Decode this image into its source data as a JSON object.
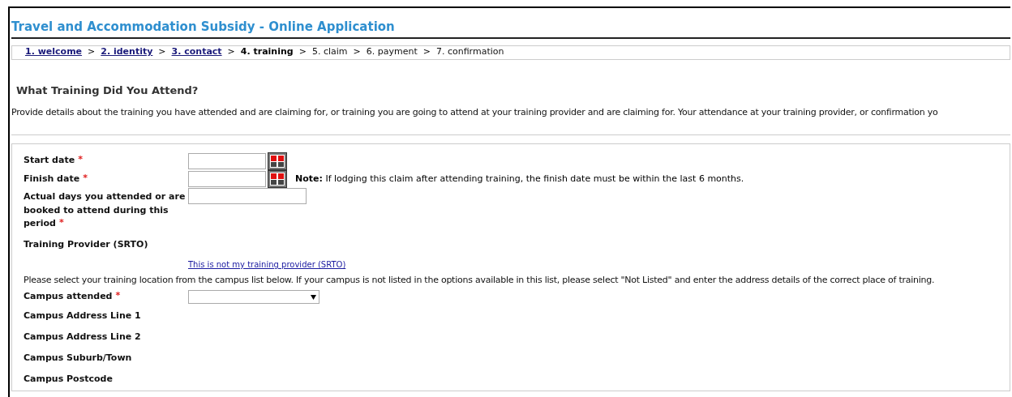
{
  "title": "Travel and Accommodation Subsidy - Online Application",
  "breadcrumb": {
    "separator": ">",
    "steps": [
      {
        "label": "1. welcome",
        "kind": "link"
      },
      {
        "label": "2. identity",
        "kind": "link"
      },
      {
        "label": "3. contact",
        "kind": "link"
      },
      {
        "label": "4. training",
        "kind": "current"
      },
      {
        "label": "5. claim",
        "kind": "plain"
      },
      {
        "label": "6. payment",
        "kind": "plain"
      },
      {
        "label": "7. confirmation",
        "kind": "plain"
      }
    ]
  },
  "heading": "What Training Did You Attend?",
  "intro": "Provide details about the training you have attended and are claiming for, or training you are going to attend at your training provider and are claiming for. Your attendance at your training provider, or confirmation yo",
  "rows": [
    {
      "kind": "date",
      "label": "Start date",
      "required_mark": "*"
    },
    {
      "kind": "date",
      "label": "Finish date",
      "required_mark": "*",
      "note_label": "Note:",
      "note": "If lodging this claim after attending training, the finish date must be within the last 6 months."
    },
    {
      "kind": "text",
      "label": "Actual days you attended or are booked to attend during this period",
      "required_mark": "*"
    },
    {
      "kind": "info",
      "label": "Training Provider (SRTO)"
    },
    {
      "kind": "link",
      "link": "This is not my training provider (SRTO)"
    },
    {
      "kind": "sentence",
      "text": "Please select your training location from the campus list below. If your campus is not listed in the options available in this list, please select \"Not Listed\" and enter the address details of the correct place of training."
    },
    {
      "kind": "select",
      "label": "Campus attended",
      "required_mark": "*"
    },
    {
      "kind": "info",
      "label": "Campus Address Line 1"
    },
    {
      "kind": "info",
      "label": "Campus Address Line 2"
    },
    {
      "kind": "info",
      "label": "Campus Suburb/Town"
    },
    {
      "kind": "info",
      "label": "Campus Postcode"
    }
  ]
}
